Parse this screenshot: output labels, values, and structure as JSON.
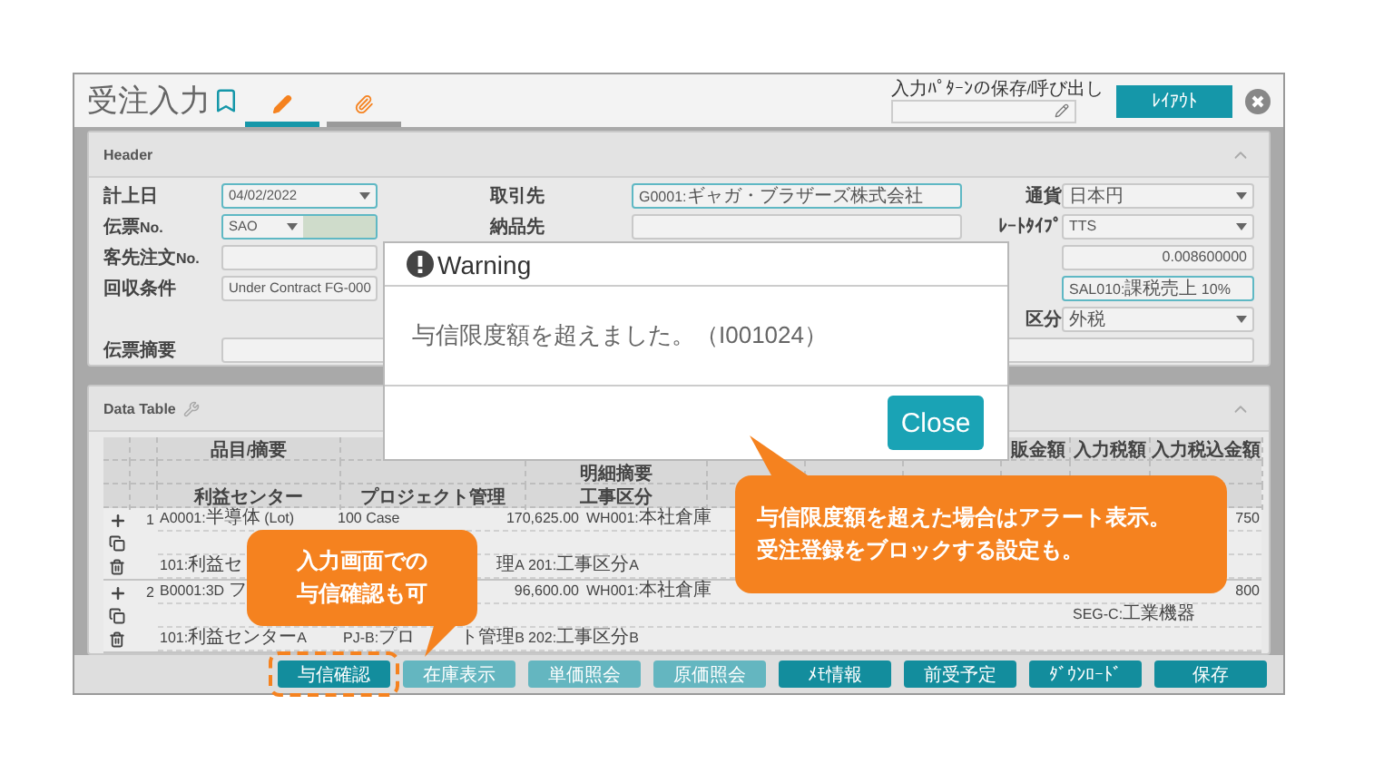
{
  "page": {
    "title": "受注入力"
  },
  "tabs": [
    {
      "kind": "edit",
      "selected": true
    },
    {
      "kind": "attachment",
      "selected": false
    }
  ],
  "pattern": {
    "label": "入力ﾊﾟﾀｰﾝの保存/呼び出し"
  },
  "layout_button": "ﾚｲｱｳﾄ",
  "header_panel": {
    "title": "Header",
    "rows": [
      {
        "left": {
          "label": "計上日",
          "kind": "select",
          "value": "04/02/2022",
          "outlined": true
        },
        "middle": {
          "label": "取引先",
          "kind": "text",
          "value": "G0001:ギャガ・ブラザーズ株式会社",
          "outlined": true
        },
        "right": {
          "label": "通貨",
          "kind": "select",
          "value": "日本円",
          "outlined": false
        }
      },
      {
        "left": {
          "label": "伝票No.",
          "kind": "code_select",
          "value": "SAO",
          "outlined": true
        },
        "middle": {
          "label": "納品先",
          "kind": "text",
          "outlined": false
        },
        "right": {
          "label": "ﾚｰﾄﾀｲﾌﾟ",
          "kind": "select",
          "value": "TTS",
          "outlined": false
        }
      },
      {
        "left": {
          "label": "客先注文No.",
          "kind": "text",
          "outlined": false
        },
        "right": {
          "kind": "number",
          "value": "0.008600000",
          "outlined": false
        }
      },
      {
        "left": {
          "label": "回収条件",
          "kind": "text",
          "value": "Under Contract FG-000",
          "outlined": false
        },
        "right": {
          "kind": "text",
          "value": "SAL010:課税売上 10%",
          "outlined": true
        }
      },
      {
        "right": {
          "label": "区分",
          "kind": "select",
          "value": "外税",
          "outlined": false
        }
      },
      {
        "left": {
          "label": "伝票摘要",
          "kind": "wide",
          "outlined": false
        }
      }
    ]
  },
  "data_table": {
    "title": "Data Table",
    "columns_top": {
      "item": "品目/摘要",
      "column_9": "販金額",
      "input_tax": "入力税額",
      "input_tax_included": "入力税込金額"
    },
    "columns_middle": {
      "line_description": "明細摘要"
    },
    "columns_bottom": {
      "profit_center": "利益センター",
      "project": "プロジェクト管理",
      "construction": "工事区分"
    },
    "rows": [
      {
        "number": "1",
        "line1": {
          "item": "A0001:半導体 (Lot)",
          "quantity": "100 Case",
          "amount": "170,625.00",
          "warehouse": "WH001:本社倉庫",
          "column_11": "750"
        },
        "line3": {
          "profit_center": "101:利益セ",
          "project": [
            "理A"
          ],
          "construction": "201:工事区分A"
        }
      },
      {
        "number": "2",
        "line1": {
          "item": "B0001:3D フ",
          "amount": "96,600.00",
          "warehouse": "WH001:本社倉庫",
          "column_11": "800"
        },
        "line2": {
          "segment": "SEG-C:工業機器"
        },
        "line3": {
          "profit_center": "101:利益センターA",
          "project": [
            "PJ-B:プロ",
            "ト管理B"
          ],
          "construction": "202:工事区分B"
        }
      }
    ]
  },
  "buttons": [
    {
      "label": "与信確認",
      "disabled": false,
      "highlighted": true
    },
    {
      "label": "在庫表示",
      "disabled": true,
      "highlighted": false
    },
    {
      "label": "単価照会",
      "disabled": true,
      "highlighted": false
    },
    {
      "label": "原価照会",
      "disabled": true,
      "highlighted": false
    },
    {
      "label": "ﾒﾓ情報",
      "disabled": false,
      "highlighted": false
    },
    {
      "label": "前受予定",
      "disabled": false,
      "highlighted": false
    },
    {
      "label": "ﾀﾞｳﾝﾛｰﾄﾞ",
      "disabled": false,
      "highlighted": false
    },
    {
      "label": "保存",
      "disabled": false,
      "highlighted": false
    }
  ],
  "modal": {
    "title": "Warning",
    "message": "与信限度額を超えました。（I001024）",
    "button": "Close"
  },
  "callouts": [
    {
      "lines": [
        "入力画面での",
        "与信確認も可"
      ]
    },
    {
      "lines": [
        "与信限度額を超えた場合はアラート表示。",
        "受注登録をブロックする設定も。"
      ]
    }
  ]
}
